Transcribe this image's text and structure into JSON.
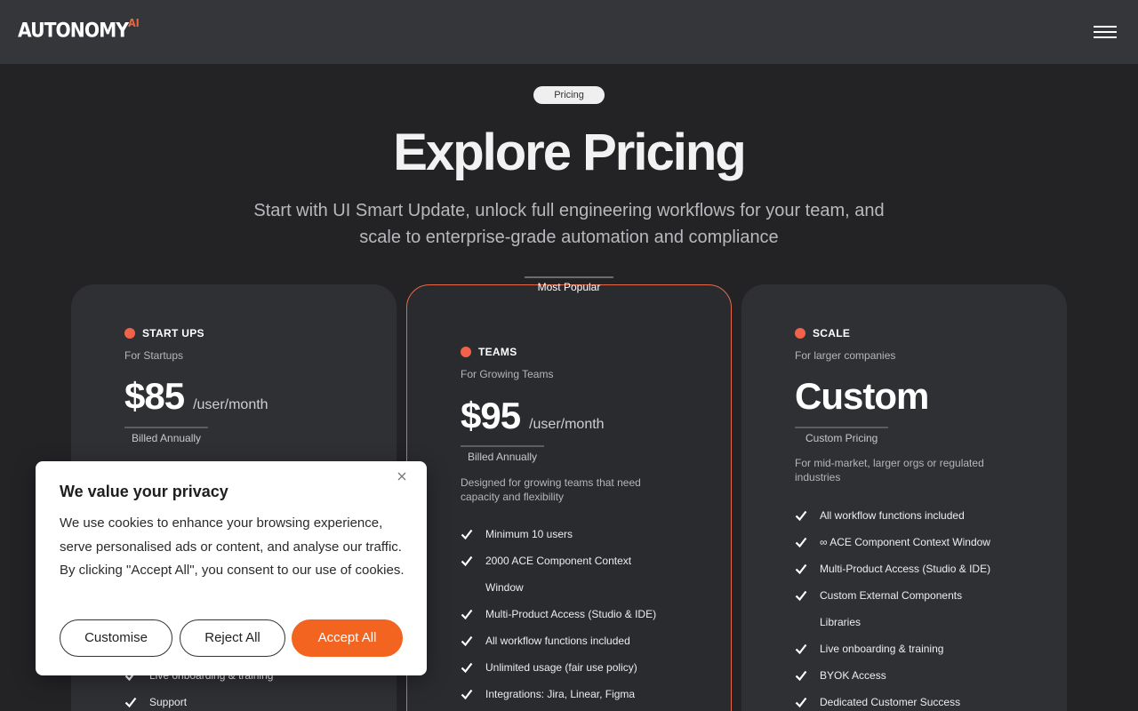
{
  "header": {
    "logo_text": "AUTONOMY",
    "logo_sup": "AI",
    "menu_icon": "hamburger-menu-icon"
  },
  "hero": {
    "pill": "Pricing",
    "title": "Explore Pricing",
    "subtitle": "Start with UI Smart Update, unlock full engineering workflows for your team, and scale to enterprise-grade automation and compliance"
  },
  "plans": {
    "popular_label": "Most Popular",
    "accent_color": "#f0634a",
    "startups": {
      "name": "START UPS",
      "for": "For Startups",
      "price": "$85",
      "unit": "/user/month",
      "billed": "Billed Annually",
      "features": [
        "Live onboarding & training",
        "Support"
      ]
    },
    "teams": {
      "name": "TEAMS",
      "for": "For Growing Teams",
      "price": "$95",
      "unit": "/user/month",
      "billed": "Billed Annually",
      "description": "Designed for growing teams that need capacity and flexibility",
      "features": [
        "Minimum 10 users",
        "2000 ACE Component Context Window",
        "Multi-Product Access (Studio & IDE)",
        "All workflow functions included",
        "Unlimited usage (fair use policy)",
        "Integrations: Jira, Linear, Figma"
      ]
    },
    "scale": {
      "name": "SCALE",
      "for": "For larger companies",
      "price": "Custom",
      "billed": "Custom Pricing",
      "description": "For mid-market, larger orgs or regulated industries",
      "features": [
        "All workflow functions included",
        "∞ ACE Component Context Window",
        "Multi-Product Access (Studio & IDE)",
        "Custom External Components Libraries",
        "Live onboarding & training",
        "BYOK Access",
        "Dedicated Customer Success"
      ]
    }
  },
  "cookie": {
    "title": "We value your privacy",
    "text": "We use cookies to enhance your browsing experience, serve personalised ads or content, and analyse our traffic. By clicking \"Accept All\", you consent to our use of cookies.",
    "customise": "Customise",
    "reject": "Reject All",
    "accept": "Accept All",
    "accept_color": "#f2641f"
  }
}
